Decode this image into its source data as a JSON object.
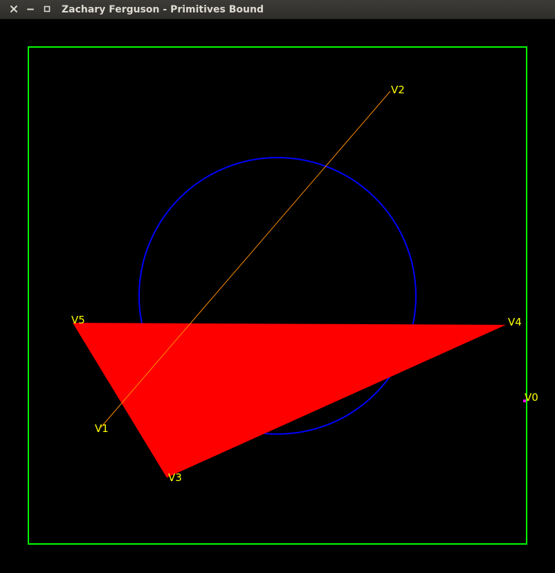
{
  "window": {
    "title": "Zachary Ferguson - Primitives Bound",
    "controls": {
      "close_icon": "close-icon",
      "minimize_icon": "minimize-icon",
      "maximize_icon": "maximize-icon"
    }
  },
  "scene": {
    "colors": {
      "background": "#000000",
      "bounding_box": "#00ff00",
      "circle": "#0000ff",
      "line": "#ff8c00",
      "triangle": "#ff0000",
      "point": "#ff00ff",
      "label": "#ffff00"
    },
    "vertex_labels": {
      "v0": "V0",
      "v1": "V1",
      "v2": "V2",
      "v3": "V3",
      "v4": "V4",
      "v5": "V5"
    }
  }
}
